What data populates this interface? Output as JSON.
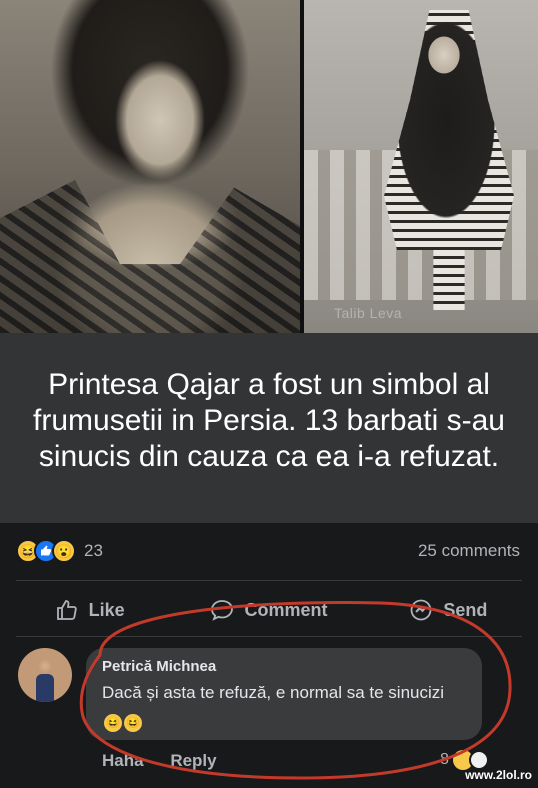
{
  "photos": {
    "left": {
      "alt_icon": "portrait-photo"
    },
    "right": {
      "watermark": "Talib Leva"
    }
  },
  "post": {
    "caption": "Printesa Qajar a fost un simbol al frumusetii in Persia. 13 barbati s-au sinucis din cauza ca ea i-a refuzat."
  },
  "stats": {
    "reaction_count": "23",
    "comments_label": "25 comments",
    "reaction_icons": [
      "haha-icon",
      "like-icon",
      "wow-icon"
    ]
  },
  "actions": {
    "like": "Like",
    "comment": "Comment",
    "send": "Send"
  },
  "comment": {
    "author": "Petrică Michnea",
    "text": "Dacă și asta te refuză, e normal sa te sinucizi",
    "emojis": [
      "haha-icon",
      "haha-icon"
    ],
    "haha": "Haha",
    "reply": "Reply",
    "reaction_count": "8"
  },
  "site": {
    "watermark": "www.2lol.ro"
  },
  "colors": {
    "background": "#18191b",
    "caption_panel": "#323436",
    "bubble": "#3a3b3c",
    "text_primary": "#e4e6eb",
    "text_secondary": "#b0b3b8",
    "annotation_ring": "#c43a2a"
  }
}
